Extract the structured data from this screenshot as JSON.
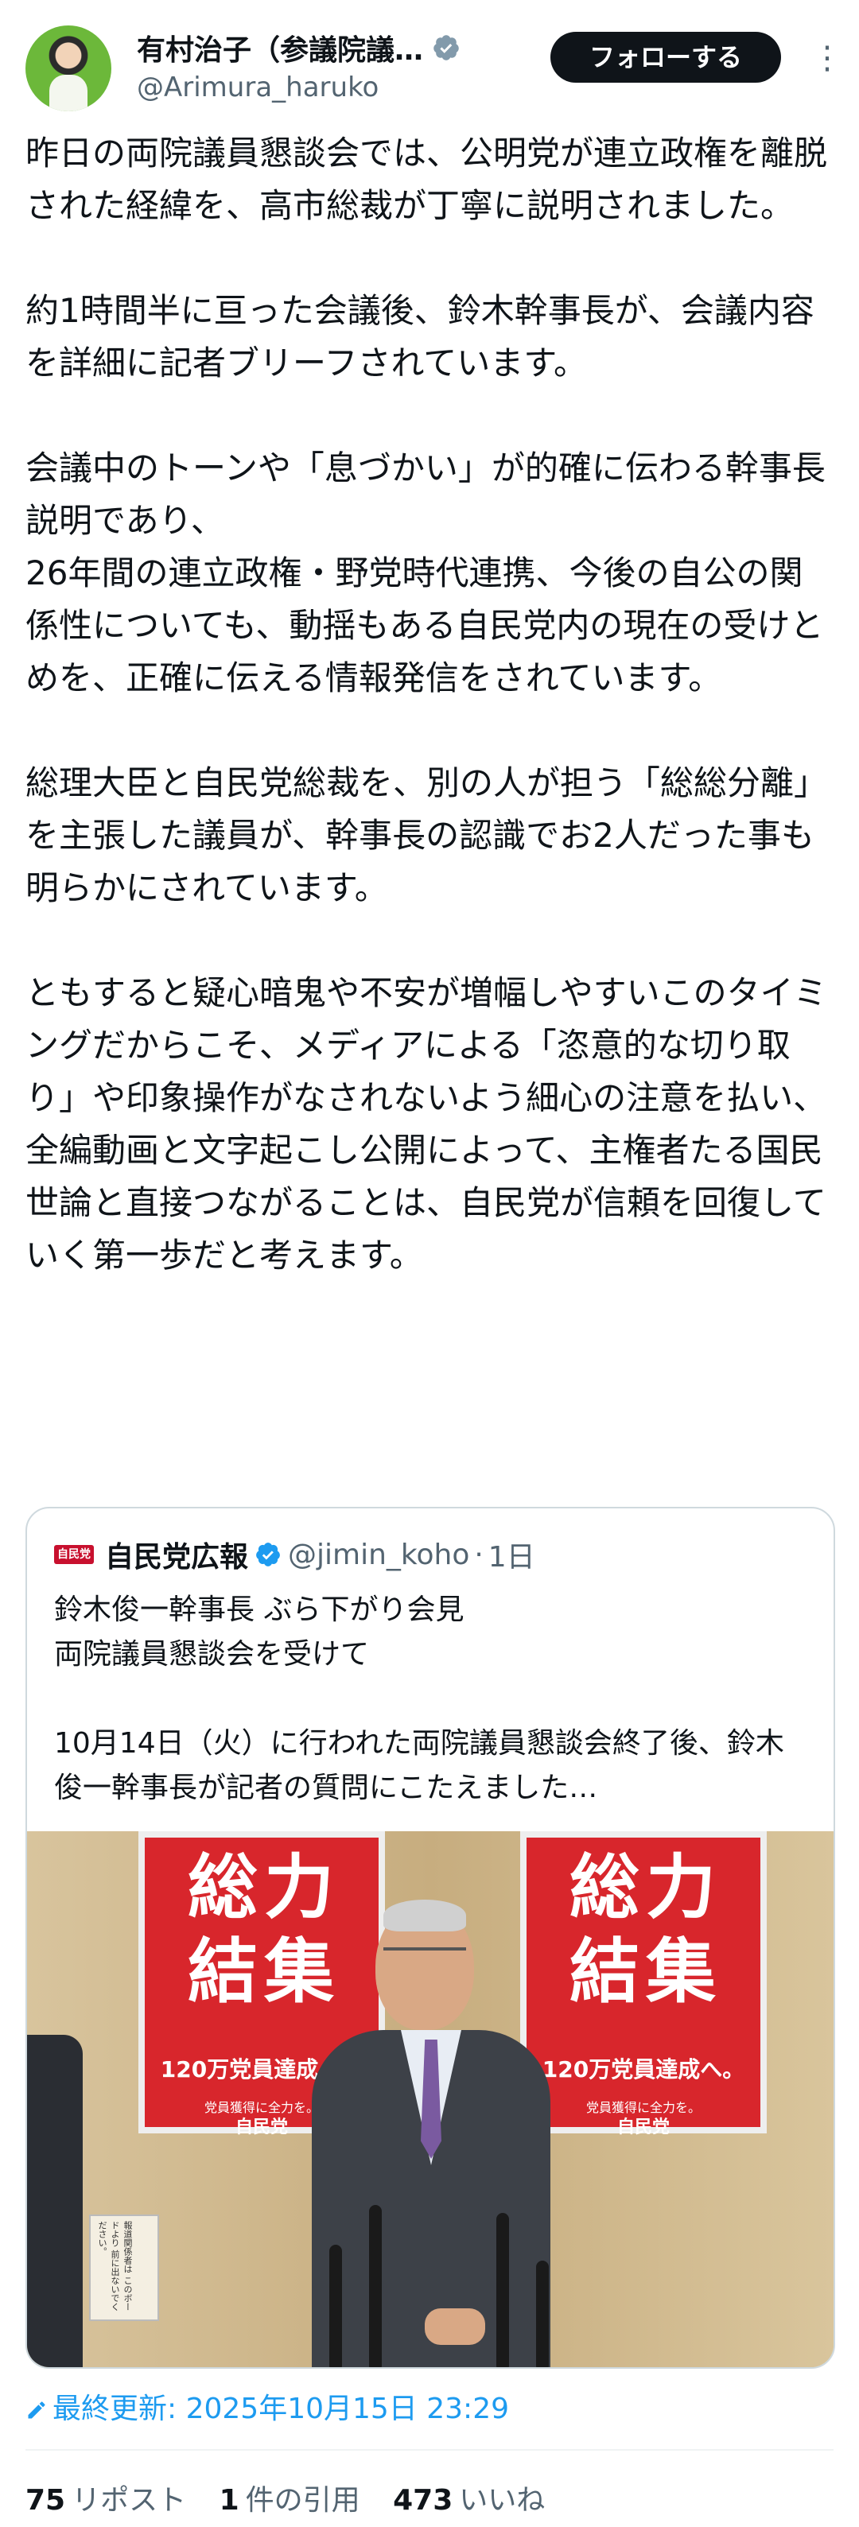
{
  "author": {
    "display_name": "有村治子（参議院議…",
    "handle": "@Arimura_haruko",
    "follow_label": "フォローする"
  },
  "tweet": {
    "text": "昨日の両院議員懇談会では、公明党が連立政権を離脱された経緯を、高市総裁が丁寧に説明されました。\n\n約1時間半に亘った会議後、鈴木幹事長が、会議内容を詳細に記者ブリーフされています。\n\n会議中のトーンや「息づかい」が的確に伝わる幹事長説明であり、\n26年間の連立政権・野党時代連携、今後の自公の関係性についても、動揺もある自民党内の現在の受けとめを、正確に伝える情報発信をされています。\n\n総理大臣と自民党総裁を、別の人が担う「総総分離」を主張した議員が、幹事長の認識でお2人だった事も明らかにされています。\n\nともすると疑心暗鬼や不安が増幅しやすいこのタイミングだからこそ、メディアによる「恣意的な切り取り」や印象操作がなされないよう細心の注意を払い、全編動画と文字起こし公開によって、主権者たる国民世論と直接つながることは、自民党が信頼を回復していく第一歩だと考えます。"
  },
  "quoted": {
    "logo_text": "自民党",
    "name": "自民党広報",
    "handle": "@jimin_koho",
    "dot": "·",
    "time": "1日",
    "text": "鈴木俊一幹事長 ぶら下がり会見\n両院議員懇談会を受けて\n\n10月14日（火）に行われた両院議員懇談会終了後、鈴木俊一幹事長が記者の質問にこたえました…",
    "photo": {
      "poster_line1": "総力",
      "poster_line2": "結集",
      "poster_sub": "120万党員達成へ。",
      "poster_foot": "党員獲得に全力を。",
      "poster_logo": "自民党",
      "sign_text": "報道関係者は このボードより 前に出ないでください。"
    }
  },
  "timestamp": {
    "label": "最終更新: 2025年10月15日 23:29"
  },
  "stats": {
    "reposts_count": "75",
    "reposts_label": "リポスト",
    "quotes_count": "1",
    "quotes_label": "件の引用",
    "likes_count": "473",
    "likes_label": "いいね"
  },
  "colors": {
    "accent": "#1d9bf0",
    "text": "#0f1419",
    "muted": "#536471",
    "poster_red": "#d8262c"
  }
}
